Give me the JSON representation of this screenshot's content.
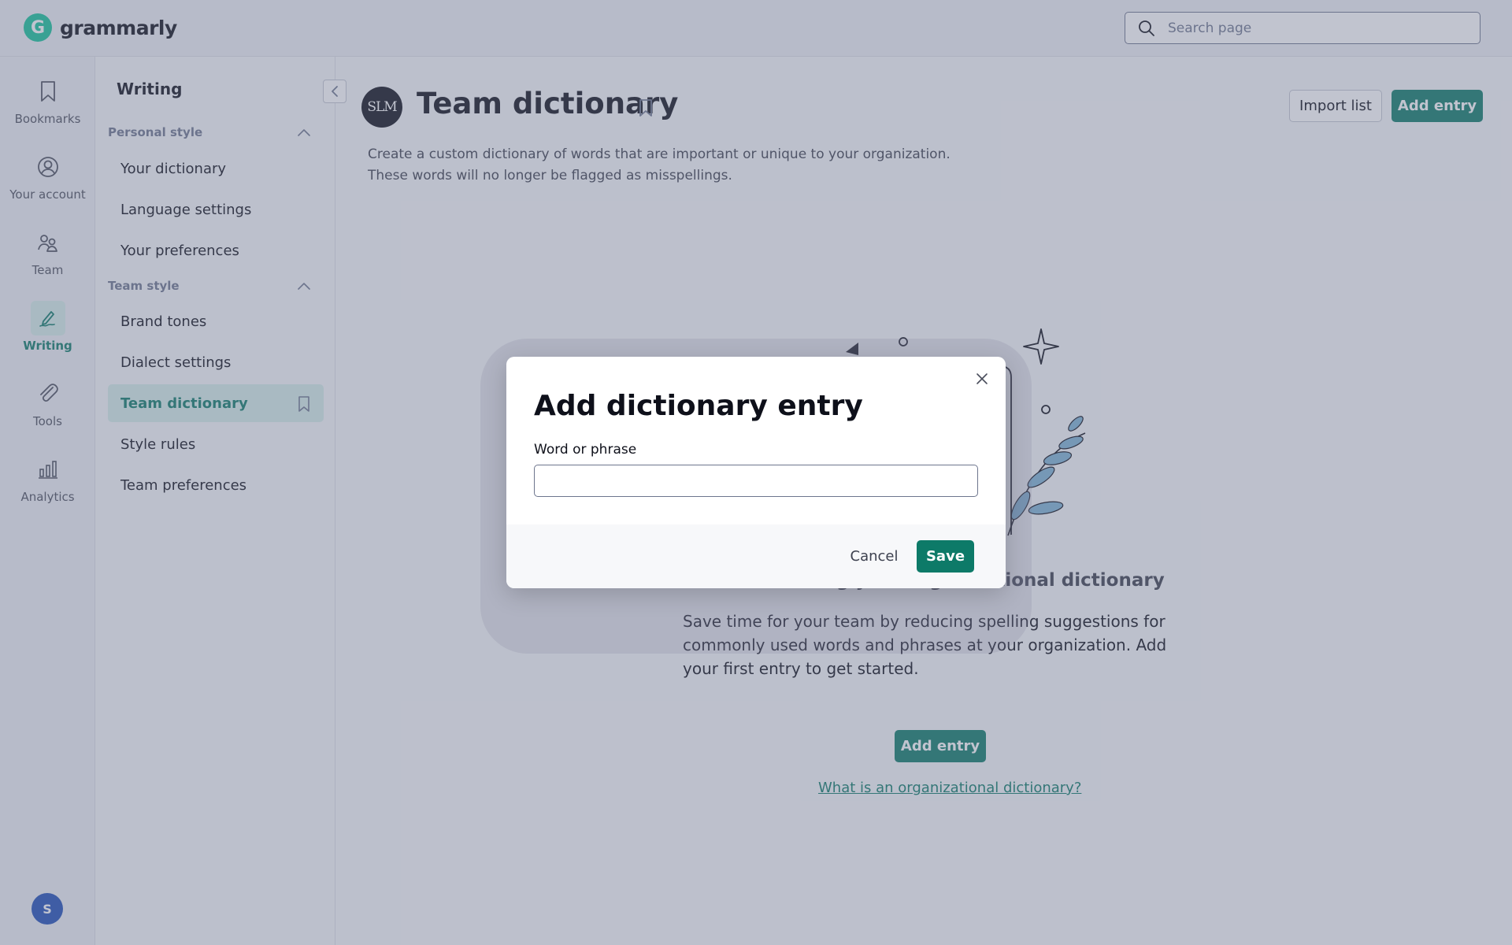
{
  "app": {
    "brand": "grammarly"
  },
  "search": {
    "placeholder": "Search page"
  },
  "rail": {
    "items": [
      {
        "label": "Bookmarks",
        "icon": "bookmark-icon"
      },
      {
        "label": "Your account",
        "icon": "account-icon"
      },
      {
        "label": "Team",
        "icon": "team-icon"
      },
      {
        "label": "Writing",
        "icon": "pen-icon",
        "active": true
      },
      {
        "label": "Tools",
        "icon": "paperclip-icon"
      },
      {
        "label": "Analytics",
        "icon": "bar-chart-icon"
      }
    ],
    "user_initial": "S"
  },
  "sidebar": {
    "title": "Writing",
    "sections": [
      {
        "label": "Personal style",
        "items": [
          "Your dictionary",
          "Language settings",
          "Your preferences"
        ]
      },
      {
        "label": "Team style",
        "items": [
          "Brand tones",
          "Dialect settings",
          "Team dictionary",
          "Style rules",
          "Team preferences"
        ]
      }
    ],
    "active_item": "Team dictionary"
  },
  "main": {
    "team_avatar": "SLM",
    "title": "Team dictionary",
    "import_label": "Import list",
    "add_entry_label": "Add entry",
    "description_line1": "Create a custom dictionary of words that are important or unique to your organization.",
    "description_line2": "These words will no longer be flagged as misspellings.",
    "empty_title": "Start creating your organizational dictionary",
    "empty_body": "Save time for your team by reducing spelling suggestions for commonly used words and phrases at your organization. Add your first entry to get started.",
    "empty_add_label": "Add entry",
    "help_link": "What is an organizational dictionary?"
  },
  "modal": {
    "title": "Add dictionary entry",
    "field_label": "Word or phrase",
    "field_value": "",
    "cancel_label": "Cancel",
    "save_label": "Save"
  },
  "colors": {
    "accent": "#0d7a68",
    "brand": "#15c39a",
    "active_bg": "#d6eee9",
    "avatar": "#1f4fb7"
  }
}
